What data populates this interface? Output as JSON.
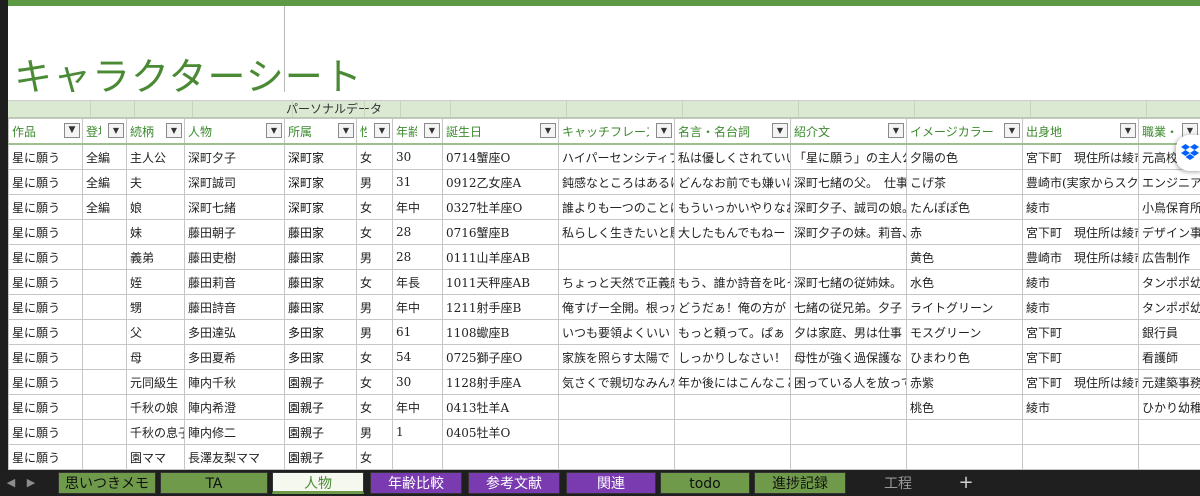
{
  "sheet": {
    "title": "キャラクターシート",
    "section_label": "パーソナルデータ"
  },
  "columns": [
    {
      "label": "作品",
      "filter": "filter-active"
    },
    {
      "label": "登場",
      "filter": "dropdown"
    },
    {
      "label": "続柄",
      "filter": "dropdown"
    },
    {
      "label": "人物",
      "filter": "dropdown"
    },
    {
      "label": "所属",
      "filter": "dropdown"
    },
    {
      "label": "性",
      "filter": "dropdown"
    },
    {
      "label": "年齢",
      "filter": "dropdown"
    },
    {
      "label": "誕生日",
      "filter": "dropdown"
    },
    {
      "label": "キャッチフレーズ",
      "filter": "dropdown"
    },
    {
      "label": "名言・名台詞",
      "filter": "dropdown"
    },
    {
      "label": "紹介文",
      "filter": "dropdown"
    },
    {
      "label": "イメージカラー",
      "filter": "dropdown"
    },
    {
      "label": "出身地",
      "filter": "dropdown"
    },
    {
      "label": "職業・所属",
      "filter": "dropdown"
    }
  ],
  "rows": [
    [
      "星に願う",
      "全編",
      "主人公",
      "深町夕子",
      "深町家",
      "女",
      "30",
      "0714蟹座O",
      "ハイパーセンシティブ",
      "私は優しくされていい",
      "「星に願う」の主人公",
      "夕陽の色",
      "宮下町　現住所は綾市",
      "元高校"
    ],
    [
      "星に願う",
      "全編",
      "夫",
      "深町誠司",
      "深町家",
      "男",
      "31",
      "0912乙女座A",
      "鈍感なところはあるけど",
      "どんなお前でも嫌いに",
      "深町七緒の父。　仕事",
      "こげ茶",
      "豊崎市(実家からスク",
      "エンジニア"
    ],
    [
      "星に願う",
      "全編",
      "娘",
      "深町七緒",
      "深町家",
      "女",
      "年中",
      "0327牡羊座O",
      "誰よりも一つのことに",
      "もういっかいやりなおし",
      "深町夕子、誠司の娘。",
      "たんぽぽ色",
      "綾市",
      "小鳥保育所"
    ],
    [
      "星に願う",
      "",
      "妹",
      "藤田朝子",
      "藤田家",
      "女",
      "28",
      "0716蟹座B",
      "私らしく生きたいと願う",
      "大したもんでもねー",
      "深町夕子の妹。莉音、",
      "赤",
      "宮下町　現住所は綾市",
      "デザイン事"
    ],
    [
      "星に願う",
      "",
      "義弟",
      "藤田吏樹",
      "藤田家",
      "男",
      "28",
      "0111山羊座AB",
      "",
      "",
      "",
      "黄色",
      "豊崎市　現住所は綾市",
      "広告制作"
    ],
    [
      "星に願う",
      "",
      "姪",
      "藤田莉音",
      "藤田家",
      "女",
      "年長",
      "1011天秤座AB",
      "ちょっと天然で正義感",
      "もう、誰か詩音を叱って",
      "深町七緒の従姉妹。",
      "水色",
      "綾市",
      "タンポポ幼"
    ],
    [
      "星に願う",
      "",
      "甥",
      "藤田詩音",
      "藤田家",
      "男",
      "年中",
      "1211射手座B",
      "俺すげー全開。根っから",
      "どうだぁ！俺の方が",
      "七緒の従兄弟。夕子",
      "ライトグリーン",
      "綾市",
      "タンポポ幼"
    ],
    [
      "星に願う",
      "",
      "父",
      "多田達弘",
      "多田家",
      "男",
      "61",
      "1108蠍座B",
      "いつも要領よくいい",
      "もっと頼って。ぱぁ",
      "夕は家庭、男は仕事",
      "モスグリーン",
      "宮下町",
      "銀行員"
    ],
    [
      "星に願う",
      "",
      "母",
      "多田夏希",
      "多田家",
      "女",
      "54",
      "0725獅子座O",
      "家族を照らす太陽で",
      "しっかりしなさい！",
      "母性が強く過保護な",
      "ひまわり色",
      "宮下町",
      "看護師"
    ],
    [
      "星に願う",
      "",
      "元同級生",
      "陣内千秋",
      "園親子",
      "女",
      "30",
      "1128射手座A",
      "気さくで親切なみんな",
      "年か後にはこんなこと",
      "困っている人を放って",
      "赤紫",
      "宮下町　現住所は綾市",
      "元建築事務"
    ],
    [
      "星に願う",
      "",
      "千秋の娘",
      "陣内希澄",
      "園親子",
      "女",
      "年中",
      "0413牡羊A",
      "",
      "",
      "",
      "桃色",
      "綾市",
      "ひかり幼稚"
    ],
    [
      "星に願う",
      "",
      "千秋の息子",
      "陣内修二",
      "園親子",
      "男",
      "1",
      "0405牡羊O",
      "",
      "",
      "",
      "",
      "",
      ""
    ],
    [
      "星に願う",
      "",
      "園ママ",
      "長澤友梨ママ",
      "園親子",
      "女",
      "",
      "",
      "",
      "",
      "",
      "",
      "",
      ""
    ]
  ],
  "bold_column_index": 4,
  "tabs": [
    {
      "label": "思いつきメモ",
      "style": "green"
    },
    {
      "label": "TA",
      "style": "green"
    },
    {
      "label": "人物",
      "style": "active"
    },
    {
      "label": "年齢比較",
      "style": "purple"
    },
    {
      "label": "参考文献",
      "style": "purple"
    },
    {
      "label": "関連",
      "style": "purple"
    },
    {
      "label": "todo",
      "style": "green"
    },
    {
      "label": "進捗記録",
      "style": "green"
    },
    {
      "label": "工程",
      "style": "dark"
    }
  ],
  "add_tab_label": "+",
  "colors": {
    "accent_green": "#5e9a46",
    "header_text": "#3c8a2e",
    "tab_purple": "#7a3bb0",
    "tab_green": "#6e9a4a"
  },
  "icons": {
    "nav_prev": "triangle-left",
    "nav_next": "triangle-right",
    "filter": "filter-icon",
    "dropdown": "chevron-down-icon",
    "dropbox": "dropbox-icon"
  }
}
